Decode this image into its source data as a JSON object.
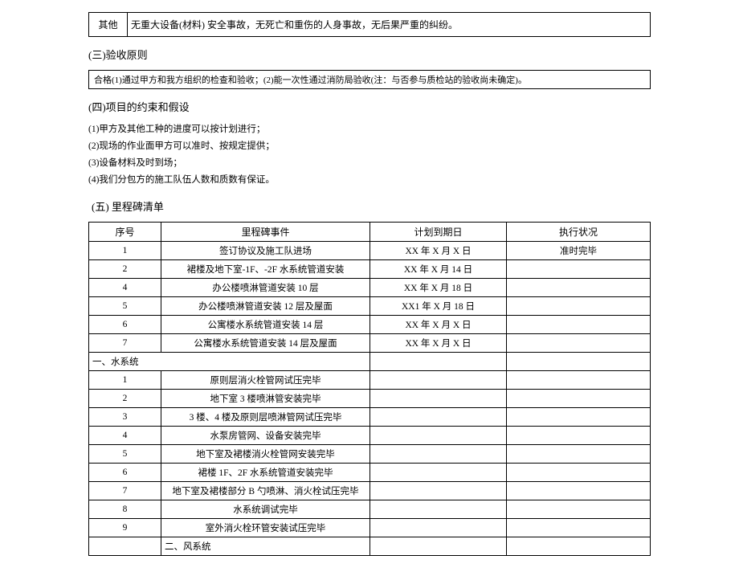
{
  "top_box": {
    "label": "其他",
    "content": "无重大设备(材料) 安全事故，无死亡和重伤的人身事故，无后果严重的纠纷。"
  },
  "section3": {
    "title": "(三)验收原则",
    "row": "合格(1)通过甲方和我方组织的检查和验收；(2)能一次性通过消防局验收(注：与否参与质检站的验收尚未确定)。"
  },
  "section4": {
    "title": "(四)项目的约束和假设",
    "items": [
      "(1)甲方及其他工种的进度可以按计划进行；",
      "(2)现场的作业面甲方可以准时、按规定提供；",
      "(3)设备材料及时到场；",
      "(4)我们分包方的施工队伍人数和质数有保证。"
    ]
  },
  "section5": {
    "title": "(五) 里程碑清单",
    "headers": [
      "序号",
      "里程碑事件",
      "计划到期日",
      "执行状况"
    ],
    "rows_top": [
      {
        "n": "1",
        "e": "签订协议及施工队进场",
        "d": "XX 年 X 月 X 日",
        "s": "准时完毕"
      },
      {
        "n": "2",
        "e": "裙楼及地下室-1F、-2F 水系统管道安装",
        "d": "XX 年 X 月 14 日",
        "s": ""
      },
      {
        "n": "4",
        "e": "办公楼喷淋管道安装 10 层",
        "d": "XX 年 X 月 18 日",
        "s": ""
      },
      {
        "n": "5",
        "e": "办公楼喷淋管道安装 12 层及屋面",
        "d": "XX1 年 X 月 18 日",
        "s": ""
      },
      {
        "n": "6",
        "e": "公寓楼水系统管道安装 14 层",
        "d": "XX 年 X 月 X 日",
        "s": ""
      },
      {
        "n": "7",
        "e": "公寓楼水系统管道安装 14 层及屋面",
        "d": "XX 年 X 月 X 日",
        "s": ""
      }
    ],
    "group_a_label": "一、水系统",
    "rows_a": [
      {
        "n": "1",
        "e": "原则层消火栓管网试压完毕",
        "d": "",
        "s": ""
      },
      {
        "n": "2",
        "e": "地下室 3 楼喷淋管安装完毕",
        "d": "",
        "s": ""
      },
      {
        "n": "3",
        "e": "3 楼、4 楼及原则层喷淋管网试压完毕",
        "d": "",
        "s": ""
      },
      {
        "n": "4",
        "e": "水泵房管网、设备安装完毕",
        "d": "",
        "s": ""
      },
      {
        "n": "5",
        "e": "地下室及裙楼消火栓管网安装完毕",
        "d": "",
        "s": ""
      },
      {
        "n": "6",
        "e": "裙楼 1F、2F 水系统管道安装完毕",
        "d": "",
        "s": ""
      },
      {
        "n": "7",
        "e": "地下室及裙楼部分 B 勺喷淋、消火栓试压完毕",
        "d": "",
        "s": ""
      },
      {
        "n": "8",
        "e": "水系统调试完毕",
        "d": "",
        "s": ""
      },
      {
        "n": "9",
        "e": "室外消火栓环管安装试压完毕",
        "d": "",
        "s": ""
      }
    ],
    "group_b_label": "二、风系统"
  }
}
